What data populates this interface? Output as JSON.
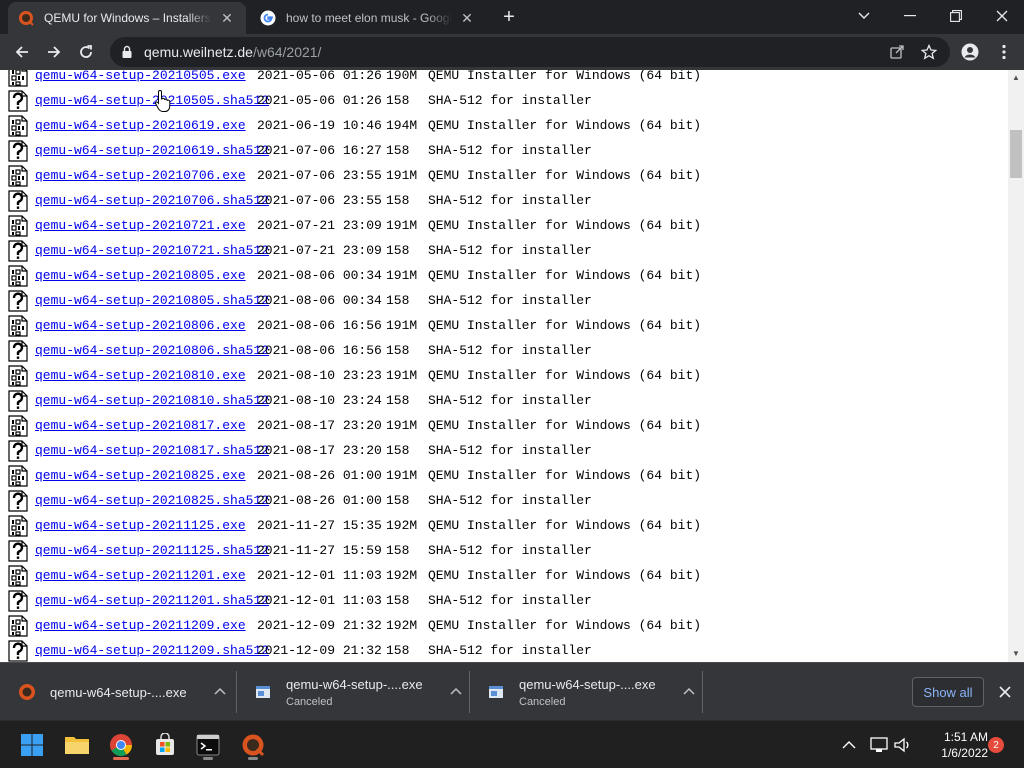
{
  "browser": {
    "tabs": [
      {
        "title": "QEMU for Windows – Installers (64 bit)",
        "active": true,
        "favicon": "qemu-icon"
      },
      {
        "title": "how to meet elon musk - Google Search",
        "active": false,
        "favicon": "google-icon"
      }
    ],
    "new_tab_label": "+",
    "address": {
      "domain": "qemu.weilnetz.de",
      "path": "/w64/2021/"
    }
  },
  "listing": [
    {
      "name": "qemu-w64-setup-20210505.exe",
      "date": "2021-05-06 01:26",
      "size": "190M",
      "desc": "QEMU Installer for Windows (64 bit)",
      "icon": "binary-file-icon"
    },
    {
      "name": "qemu-w64-setup-20210505.sha512",
      "date": "2021-05-06 01:26",
      "size": "158",
      "desc": "SHA-512 for installer",
      "icon": "unknown-file-icon"
    },
    {
      "name": "qemu-w64-setup-20210619.exe",
      "date": "2021-06-19 10:46",
      "size": "194M",
      "desc": "QEMU Installer for Windows (64 bit)",
      "icon": "binary-file-icon"
    },
    {
      "name": "qemu-w64-setup-20210619.sha512",
      "date": "2021-07-06 16:27",
      "size": "158",
      "desc": "SHA-512 for installer",
      "icon": "unknown-file-icon"
    },
    {
      "name": "qemu-w64-setup-20210706.exe",
      "date": "2021-07-06 23:55",
      "size": "191M",
      "desc": "QEMU Installer for Windows (64 bit)",
      "icon": "binary-file-icon"
    },
    {
      "name": "qemu-w64-setup-20210706.sha512",
      "date": "2021-07-06 23:55",
      "size": "158",
      "desc": "SHA-512 for installer",
      "icon": "unknown-file-icon"
    },
    {
      "name": "qemu-w64-setup-20210721.exe",
      "date": "2021-07-21 23:09",
      "size": "191M",
      "desc": "QEMU Installer for Windows (64 bit)",
      "icon": "binary-file-icon"
    },
    {
      "name": "qemu-w64-setup-20210721.sha512",
      "date": "2021-07-21 23:09",
      "size": "158",
      "desc": "SHA-512 for installer",
      "icon": "unknown-file-icon"
    },
    {
      "name": "qemu-w64-setup-20210805.exe",
      "date": "2021-08-06 00:34",
      "size": "191M",
      "desc": "QEMU Installer for Windows (64 bit)",
      "icon": "binary-file-icon"
    },
    {
      "name": "qemu-w64-setup-20210805.sha512",
      "date": "2021-08-06 00:34",
      "size": "158",
      "desc": "SHA-512 for installer",
      "icon": "unknown-file-icon"
    },
    {
      "name": "qemu-w64-setup-20210806.exe",
      "date": "2021-08-06 16:56",
      "size": "191M",
      "desc": "QEMU Installer for Windows (64 bit)",
      "icon": "binary-file-icon"
    },
    {
      "name": "qemu-w64-setup-20210806.sha512",
      "date": "2021-08-06 16:56",
      "size": "158",
      "desc": "SHA-512 for installer",
      "icon": "unknown-file-icon"
    },
    {
      "name": "qemu-w64-setup-20210810.exe",
      "date": "2021-08-10 23:23",
      "size": "191M",
      "desc": "QEMU Installer for Windows (64 bit)",
      "icon": "binary-file-icon"
    },
    {
      "name": "qemu-w64-setup-20210810.sha512",
      "date": "2021-08-10 23:24",
      "size": "158",
      "desc": "SHA-512 for installer",
      "icon": "unknown-file-icon"
    },
    {
      "name": "qemu-w64-setup-20210817.exe",
      "date": "2021-08-17 23:20",
      "size": "191M",
      "desc": "QEMU Installer for Windows (64 bit)",
      "icon": "binary-file-icon"
    },
    {
      "name": "qemu-w64-setup-20210817.sha512",
      "date": "2021-08-17 23:20",
      "size": "158",
      "desc": "SHA-512 for installer",
      "icon": "unknown-file-icon"
    },
    {
      "name": "qemu-w64-setup-20210825.exe",
      "date": "2021-08-26 01:00",
      "size": "191M",
      "desc": "QEMU Installer for Windows (64 bit)",
      "icon": "binary-file-icon"
    },
    {
      "name": "qemu-w64-setup-20210825.sha512",
      "date": "2021-08-26 01:00",
      "size": "158",
      "desc": "SHA-512 for installer",
      "icon": "unknown-file-icon"
    },
    {
      "name": "qemu-w64-setup-20211125.exe",
      "date": "2021-11-27 15:35",
      "size": "192M",
      "desc": "QEMU Installer for Windows (64 bit)",
      "icon": "binary-file-icon"
    },
    {
      "name": "qemu-w64-setup-20211125.sha512",
      "date": "2021-11-27 15:59",
      "size": "158",
      "desc": "SHA-512 for installer",
      "icon": "unknown-file-icon"
    },
    {
      "name": "qemu-w64-setup-20211201.exe",
      "date": "2021-12-01 11:03",
      "size": "192M",
      "desc": "QEMU Installer for Windows (64 bit)",
      "icon": "binary-file-icon"
    },
    {
      "name": "qemu-w64-setup-20211201.sha512",
      "date": "2021-12-01 11:03",
      "size": "158",
      "desc": "SHA-512 for installer",
      "icon": "unknown-file-icon"
    },
    {
      "name": "qemu-w64-setup-20211209.exe",
      "date": "2021-12-09 21:32",
      "size": "192M",
      "desc": "QEMU Installer for Windows (64 bit)",
      "icon": "binary-file-icon"
    },
    {
      "name": "qemu-w64-setup-20211209.sha512",
      "date": "2021-12-09 21:32",
      "size": "158",
      "desc": "SHA-512 for installer",
      "icon": "unknown-file-icon"
    }
  ],
  "downloads": {
    "items": [
      {
        "name": "qemu-w64-setup-....exe",
        "status": "",
        "icon": "qemu-icon"
      },
      {
        "name": "qemu-w64-setup-....exe",
        "status": "Canceled",
        "icon": "file-icon"
      },
      {
        "name": "qemu-w64-setup-....exe",
        "status": "Canceled",
        "icon": "file-icon"
      }
    ],
    "show_all_label": "Show all"
  },
  "taskbar": {
    "time": "1:51 AM",
    "date": "1/6/2022",
    "notification_count": "2"
  },
  "colors": {
    "link": "#0000ee",
    "accent": "#8ab4f8",
    "chrome_dark": "#35363a",
    "badge": "#e74b3c"
  }
}
